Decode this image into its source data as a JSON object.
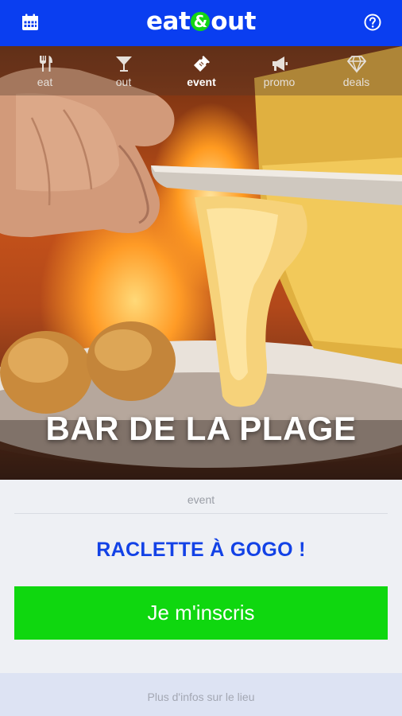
{
  "header": {
    "logo_left": "eat",
    "logo_amp": "&",
    "logo_right": "out",
    "calendar_icon": "calendar-icon",
    "help_icon": "help-circle-icon"
  },
  "nav": {
    "tabs": [
      {
        "label": "eat",
        "icon": "fork-knife-icon",
        "active": false
      },
      {
        "label": "out",
        "icon": "cocktail-glass-icon",
        "active": false
      },
      {
        "label": "event",
        "icon": "ticket-icon",
        "active": true
      },
      {
        "label": "promo",
        "icon": "megaphone-icon",
        "active": false
      },
      {
        "label": "deals",
        "icon": "diamond-icon",
        "active": false
      }
    ]
  },
  "hero": {
    "title": "BAR DE LA PLAGE"
  },
  "event": {
    "category": "event",
    "title": "RACLETTE À GOGO !",
    "cta_label": "Je m'inscris"
  },
  "footer": {
    "link_label": "Plus d'infos sur le lieu"
  },
  "colors": {
    "brand_blue": "#0a3ef0",
    "title_blue": "#1342e6",
    "cta_green": "#0fd70f",
    "footer_bg": "#dde3f3"
  }
}
